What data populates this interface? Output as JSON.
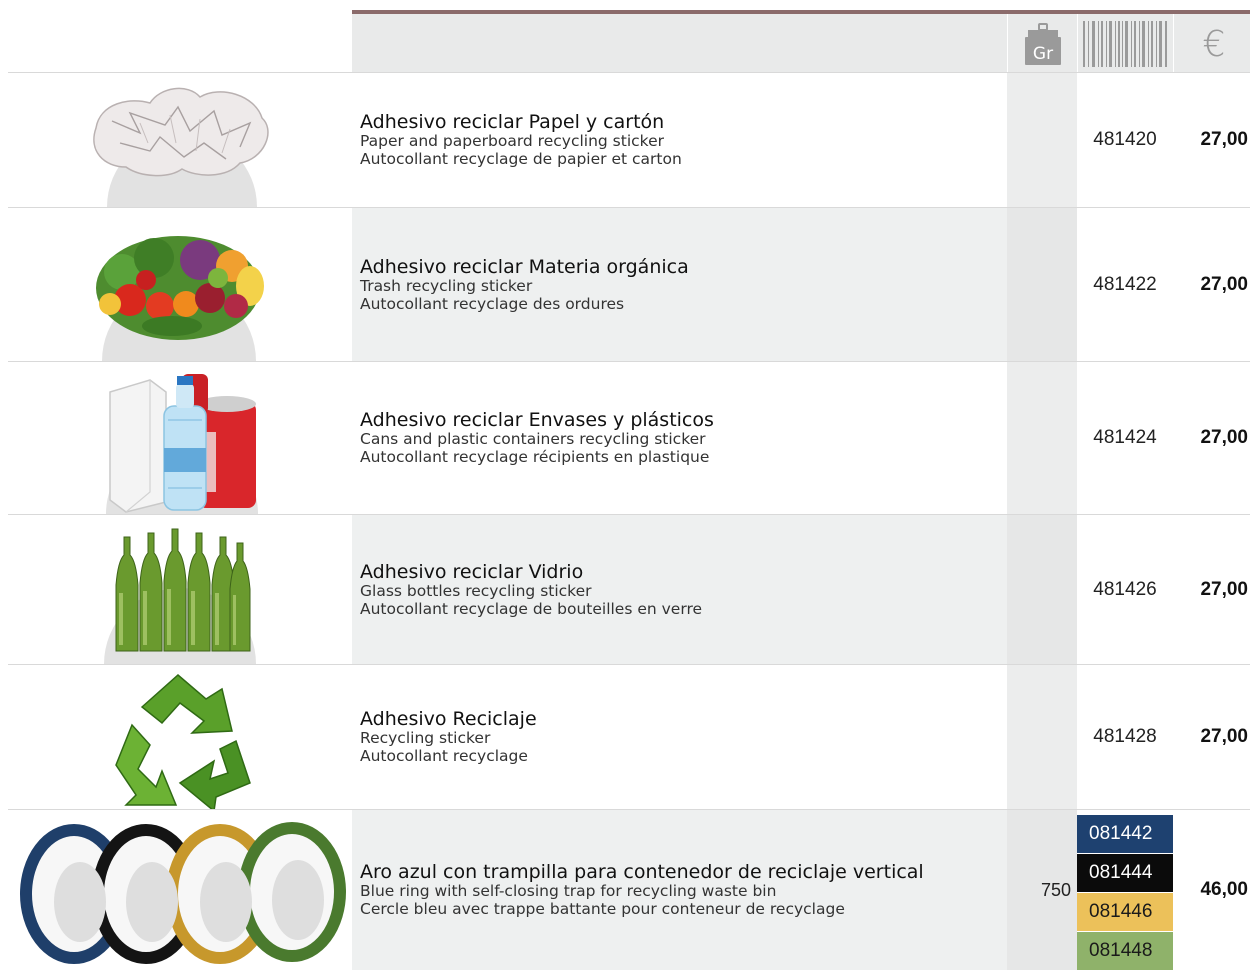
{
  "header": {
    "weight_icon": "weight-gr-icon",
    "weight_label": "Gr",
    "barcode_icon": "barcode-icon",
    "currency_symbol": "€"
  },
  "products": [
    {
      "image": "crumpled-paper-image",
      "name_es": "Adhesivo reciclar Papel y cartón",
      "name_en": "Paper and paperboard recycling sticker",
      "name_fr": "Autocollant recyclage de papier et carton",
      "weight": "",
      "code": "481420",
      "price": "27,00"
    },
    {
      "image": "fruits-vegetables-image",
      "name_es": "Adhesivo reciclar Materia orgánica",
      "name_en": "Trash recycling sticker",
      "name_fr": "Autocollant recyclage des ordures",
      "weight": "",
      "code": "481422",
      "price": "27,00"
    },
    {
      "image": "cans-plastic-bottle-image",
      "name_es": "Adhesivo reciclar Envases y plásticos",
      "name_en": "Cans and plastic containers recycling sticker",
      "name_fr": "Autocollant recyclage récipients en plastique",
      "weight": "",
      "code": "481424",
      "price": "27,00"
    },
    {
      "image": "glass-bottles-image",
      "name_es": "Adhesivo reciclar Vidrio",
      "name_en": "Glass bottles recycling sticker",
      "name_fr": "Autocollant recyclage de bouteilles en verre",
      "weight": "",
      "code": "481426",
      "price": "27,00"
    },
    {
      "image": "recycling-symbol-image",
      "name_es": "Adhesivo Reciclaje",
      "name_en": "Recycling sticker",
      "name_fr": "Autocollant recyclage",
      "weight": "",
      "code": "481428",
      "price": "27,00"
    },
    {
      "image": "colored-rings-image",
      "name_es": "Aro azul con trampilla para contenedor de reciclaje vertical",
      "name_en": "Blue ring with self-closing trap for recycling waste bin",
      "name_fr": "Cercle bleu avec trappe battante pour conteneur de recyclage",
      "weight": "750",
      "code": "",
      "price": "46,00",
      "color_codes": [
        {
          "code": "081442",
          "bg": "#1e4170",
          "fg": "#ffffff"
        },
        {
          "code": "081444",
          "bg": "#0b0b0b",
          "fg": "#ffffff"
        },
        {
          "code": "081446",
          "bg": "#ecc15a",
          "fg": "#1a1a1a"
        },
        {
          "code": "081448",
          "bg": "#8fb26a",
          "fg": "#1a1a1a"
        }
      ]
    }
  ]
}
